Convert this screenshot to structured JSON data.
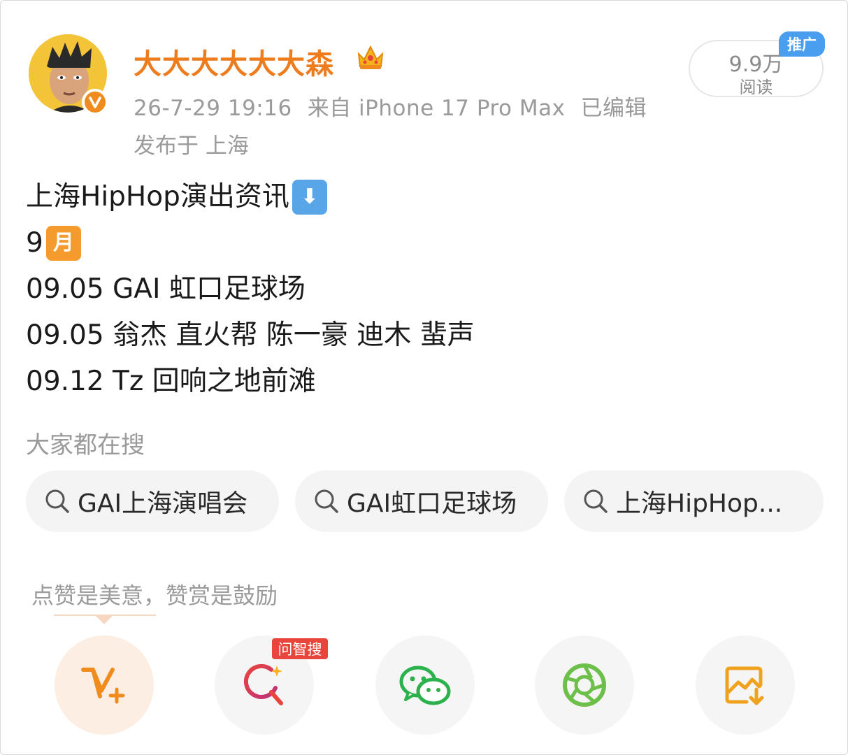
{
  "author": {
    "name": "大大大大大大森",
    "crown_icon": "crown-icon",
    "verified_icon": "verified-v-icon",
    "name_color": "#ee7b1c"
  },
  "meta": {
    "time": "26-7-29 19:16",
    "source": "来自 iPhone 17 Pro Max",
    "edited": "已编辑",
    "location": "发布于 上海"
  },
  "reads": {
    "count": "9.9万",
    "label": "阅读",
    "promo": "推广"
  },
  "post": {
    "line1": "上海HipHop演出资讯",
    "line1_emoji": "⬇",
    "line2_num": "9",
    "line2_emoji": "月",
    "line3": "09.05 GAI 虹口足球场",
    "line4": "09.05 翁杰 直火帮 陈一豪 迪木  蜚声",
    "line5": "09.12 Tz 回响之地前滩"
  },
  "search": {
    "title": "大家都在搜",
    "chips": [
      "GAI上海演唱会",
      "GAI虹口足球场",
      "上海HipHop..."
    ]
  },
  "actions": {
    "reward_text": "点赞是美意，赞赏是鼓励",
    "ai_badge": "问智搜",
    "icons": [
      "vplus-icon",
      "ai-search-icon",
      "wechat-icon",
      "moments-icon",
      "save-image-icon"
    ]
  }
}
